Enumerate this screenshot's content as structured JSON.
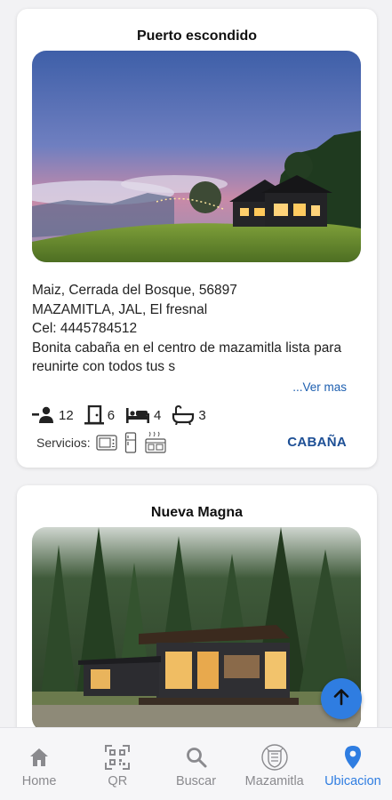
{
  "listings": [
    {
      "title": "Puerto escondido",
      "address_line1": "Maiz, Cerrada del Bosque, 56897",
      "address_line2": "MAZAMITLA, JAL, El fresnal",
      "phone": "Cel: 4445784512",
      "description": "Bonita cabaña en el centro de mazamitla lista para reunirte con todos tus s",
      "see_more": "...Ver mas",
      "guests": "12",
      "rooms": "6",
      "beds": "4",
      "baths": "3",
      "services_label": "Servicios:",
      "services_icons": [
        "microwave-icon",
        "fridge-icon",
        "grill-icon"
      ],
      "type": "CABAÑA"
    },
    {
      "title": "Nueva Magna"
    }
  ],
  "nav": [
    {
      "label": "Home",
      "icon": "home-icon"
    },
    {
      "label": "QR",
      "icon": "qr-icon"
    },
    {
      "label": "Buscar",
      "icon": "search-icon"
    },
    {
      "label": "Mazamitla",
      "icon": "crest-icon"
    },
    {
      "label": "Ubicacion",
      "icon": "location-pin-icon",
      "active": true
    }
  ],
  "colors": {
    "accent": "#2f7de1",
    "type_label": "#1d4f95",
    "link": "#1d5fb0"
  }
}
